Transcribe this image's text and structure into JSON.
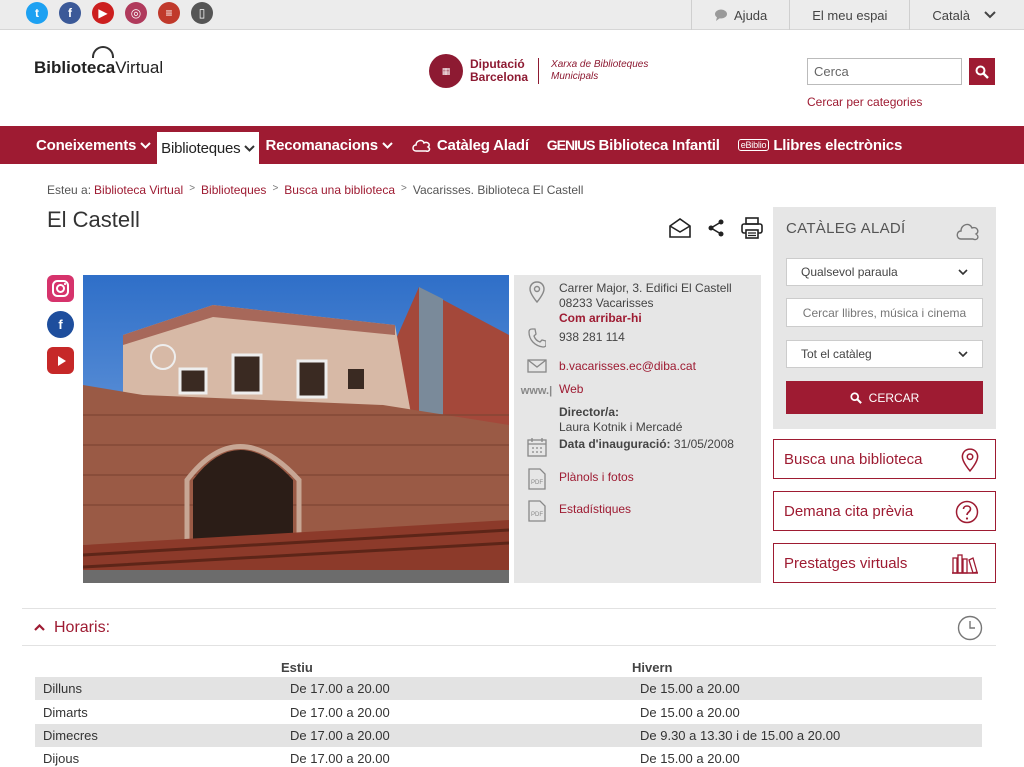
{
  "topbar": {
    "social": [
      {
        "icon": "twitter-icon",
        "glyph": "t"
      },
      {
        "icon": "facebook-icon",
        "glyph": "f"
      },
      {
        "icon": "youtube-icon",
        "glyph": "▶"
      },
      {
        "icon": "instagram-icon",
        "glyph": "◎"
      },
      {
        "icon": "blog-icon",
        "glyph": "≡"
      },
      {
        "icon": "mobile-icon",
        "glyph": "▯"
      }
    ],
    "help": "Ajuda",
    "my_space": "El meu espai",
    "language": "Català"
  },
  "header": {
    "logo_bold": "Biblioteca",
    "logo_light": "Virtual",
    "diba_line1": "Diputació",
    "diba_line2": "Barcelona",
    "xarxa_line1": "Xarxa de Biblioteques",
    "xarxa_line2": "Municipals",
    "search_placeholder": "Cerca",
    "search_categories": "Cercar per categories"
  },
  "nav": {
    "items": [
      {
        "label": "Coneixements"
      },
      {
        "label": "Biblioteques"
      },
      {
        "label": "Recomanacions"
      },
      {
        "label": "Catàleg Aladí"
      },
      {
        "label": "Biblioteca Infantil",
        "prefix": "GENIUS"
      },
      {
        "label": "Llibres electrònics",
        "prefix": "eBiblio"
      }
    ]
  },
  "breadcrumb": {
    "prefix": "Esteu a:",
    "items": [
      "Biblioteca Virtual",
      "Biblioteques",
      "Busca una biblioteca"
    ],
    "current": "Vacarisses. Biblioteca El Castell"
  },
  "page": {
    "title": "El Castell"
  },
  "info": {
    "address1": "Carrer Major, 3. Edifici El Castell",
    "address2": "08233 Vacarisses",
    "directions": "Com arribar-hi",
    "phone": "938 281 114",
    "email": "b.vacarisses.ec@diba.cat",
    "web_icon": "www.|",
    "web": "Web",
    "director_label": "Director/a:",
    "director": "Laura Kotnik i Mercadé",
    "inaug_label": "Data d'inauguració:",
    "inaug": "31/05/2008",
    "plans": "Plànols i fotos",
    "stats": "Estadístiques"
  },
  "aladi": {
    "title": "CATÀLEG ALADÍ",
    "select1": "Qualsevol paraula",
    "input_placeholder": "Cercar llibres, música i cinema",
    "select2": "Tot el catàleg",
    "button": "CERCAR"
  },
  "side_links": {
    "find": "Busca una biblioteca",
    "appointment": "Demana cita prèvia",
    "shelves": "Prestatges virtuals"
  },
  "schedule": {
    "title": "Horaris:",
    "col_summer": "Estiu",
    "col_winter": "Hivern",
    "rows": [
      {
        "day": "Dilluns",
        "summer": "De 17.00 a 20.00",
        "winter": "De 15.00 a 20.00"
      },
      {
        "day": "Dimarts",
        "summer": "De 17.00 a 20.00",
        "winter": "De 15.00 a 20.00"
      },
      {
        "day": "Dimecres",
        "summer": "De 17.00 a 20.00",
        "winter": "De 9.30 a 13.30 i de 15.00 a 20.00"
      },
      {
        "day": "Dijous",
        "summer": "De 17.00 a 20.00",
        "winter": "De 15.00 a 20.00"
      }
    ]
  },
  "colors": {
    "brand": "#9e1b32",
    "panel": "#e6e6e6"
  }
}
